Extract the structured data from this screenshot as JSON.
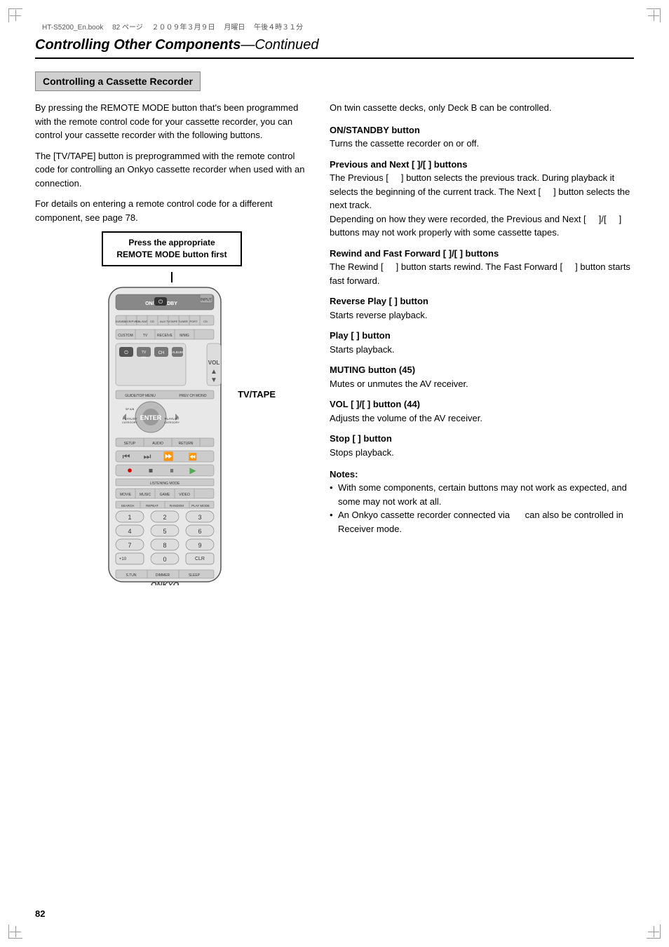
{
  "meta": {
    "file": "HT-S5200_En.book",
    "page": "82",
    "date": "２００９年３月９日",
    "day": "月曜日",
    "time": "午後４時３１分"
  },
  "header": {
    "title": "Controlling Other Components",
    "subtitle": "—Continued"
  },
  "section": {
    "title": "Controlling a Cassette Recorder"
  },
  "left_col": {
    "para1": "By pressing the REMOTE MODE button that's been programmed with the remote control code for your cassette recorder, you can control your cassette recorder with the following buttons.",
    "para2": "The [TV/TAPE] button is preprogrammed with the remote control code for controlling an Onkyo cassette recorder when used with an      connection.",
    "para3": "For details on entering a remote control code for a different component, see page 78.",
    "callout": "Press the appropriate\nREMOTE MODE button first",
    "tv_tape_label": "TV/TAPE"
  },
  "right_col": {
    "intro": "On twin cassette decks, only Deck B can be controlled.",
    "buttons": [
      {
        "title": "ON/STANDBY button",
        "body": "Turns the cassette recorder on or off."
      },
      {
        "title": "Previous and Next [      ]/[      ] buttons",
        "body": "The Previous [      ] button selects the previous track. During playback it selects the beginning of the current track. The Next [      ] button selects the next track.\nDepending on how they were recorded, the Previous and Next [      ]/[      ] buttons may not work properly with some cassette tapes."
      },
      {
        "title": "Rewind and Fast Forward [      ]/[      ] buttons",
        "body": "The Rewind [      ] button starts rewind. The Fast Forward [      ] button starts fast forward."
      },
      {
        "title": "Reverse Play [      ] button",
        "body": "Starts reverse playback."
      },
      {
        "title": "Play [      ] button",
        "body": "Starts playback."
      },
      {
        "title": "MUTING button (45)",
        "body": "Mutes or unmutes the AV receiver."
      },
      {
        "title": "VOL [      ]/[      ] button (44)",
        "body": "Adjusts the volume of the AV receiver."
      },
      {
        "title": "Stop [      ] button",
        "body": "Stops playback."
      }
    ],
    "notes": {
      "title": "Notes:",
      "items": [
        "With some components, certain buttons may not work as expected, and some may not work at all.",
        "An Onkyo cassette recorder connected via      can also be controlled in Receiver mode."
      ]
    }
  },
  "page_number": "82"
}
